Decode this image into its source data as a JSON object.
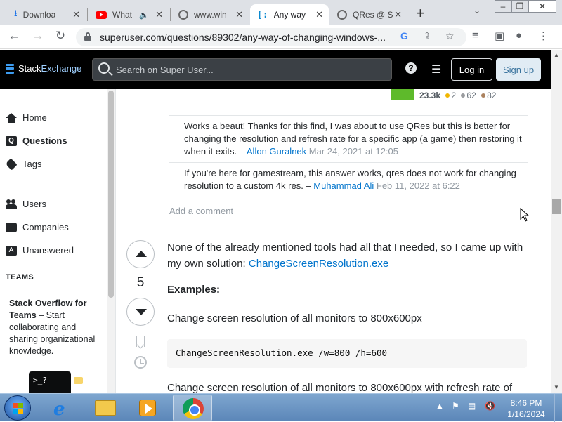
{
  "browser": {
    "tabs": [
      {
        "title": "Downloa",
        "icon": "download-icon"
      },
      {
        "title": "What",
        "icon": "youtube-icon"
      },
      {
        "title": "www.win",
        "icon": "globe-icon"
      },
      {
        "title": "Any way",
        "icon": "superuser-icon",
        "active": true
      },
      {
        "title": "QRes @ S",
        "icon": "globe-icon"
      }
    ],
    "url": "superuser.com/questions/89302/any-way-of-changing-windows-..."
  },
  "header": {
    "logo_stack": "Stack",
    "logo_exchange": "Exchange",
    "search_placeholder": "Search on Super User...",
    "login_label": "Log in",
    "signup_label": "Sign up"
  },
  "leftnav": {
    "items": [
      {
        "label": "Home"
      },
      {
        "label": "Questions"
      },
      {
        "label": "Tags"
      },
      {
        "label": "Users"
      },
      {
        "label": "Companies"
      },
      {
        "label": "Unanswered"
      }
    ],
    "teams_heading": "TEAMS",
    "teams_title": "Stack Overflow for Teams",
    "teams_dash": " – Start collaborating and sharing organizational knowledge.",
    "teams_prompt": ">_?"
  },
  "user_card": {
    "reputation": "23.3k",
    "gold": "2",
    "silver": "62",
    "bronze": "82"
  },
  "comments": [
    {
      "text": "Works a beaut! Thanks for this find, I was about to use QRes but this is better for changing the resolution and refresh rate for a specific app (a game) then restoring it when it exits. – ",
      "user": "Allon Guralnek",
      "date": "Mar 24, 2021 at 12:05"
    },
    {
      "text": "If you're here for gamestream, this answer works, qres does not work for changing resolution to a custom 4k res. – ",
      "user": "Muhammad Ali",
      "date": "Feb 11, 2022 at 6:22"
    }
  ],
  "add_comment": "Add a comment",
  "answer": {
    "score": "5",
    "intro": "None of the already mentioned tools had all that I needed, so I came up with my own solution: ",
    "link": "ChangeScreenResolution.exe",
    "examples_heading": "Examples:",
    "example1": "Change screen resolution of all monitors to 800x600px",
    "code1": "ChangeScreenResolution.exe /w=800 /h=600",
    "example2": "Change screen resolution of all monitors to 800x600px with refresh rate of"
  },
  "taskbar": {
    "time": "8:46 PM",
    "date": "1/16/2024"
  }
}
